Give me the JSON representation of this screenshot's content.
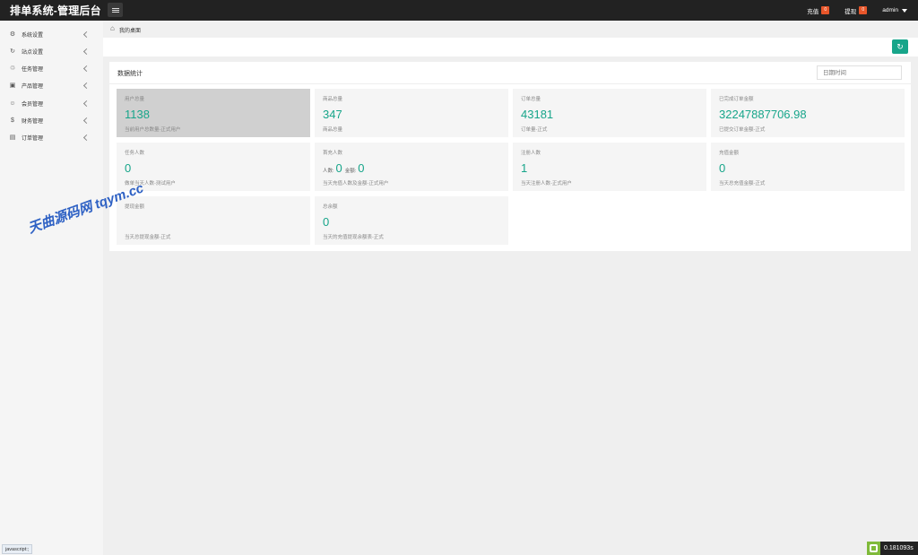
{
  "header": {
    "brand": "排单系统-管理后台",
    "recharge_label": "充值",
    "recharge_badge": "0",
    "withdraw_label": "提现",
    "withdraw_badge": "0",
    "user": "admin"
  },
  "sidebar": {
    "items": [
      {
        "label": "系统设置",
        "icon": "settings-icon"
      },
      {
        "label": "站点设置",
        "icon": "refresh-icon"
      },
      {
        "label": "任务管理",
        "icon": "task-icon"
      },
      {
        "label": "产品管理",
        "icon": "box-icon"
      },
      {
        "label": "会员管理",
        "icon": "user-icon"
      },
      {
        "label": "财务管理",
        "icon": "dollar-icon"
      },
      {
        "label": "订单管理",
        "icon": "order-icon"
      }
    ]
  },
  "breadcrumb": {
    "current": "我的桌面"
  },
  "panel": {
    "title": "数据统计",
    "date_placeholder": "日期时间"
  },
  "cards": [
    {
      "label": "用户总量",
      "value": "1138",
      "sub": "当前用户总数量-正式用户"
    },
    {
      "label": "商品总量",
      "value": "347",
      "sub": "商品总量"
    },
    {
      "label": "订单总量",
      "value": "43181",
      "sub": "订单量-正式"
    },
    {
      "label": "已完成订单金额",
      "value": "32247887706.98",
      "sub": "已提交订单金额-正式"
    },
    {
      "label": "任务人数",
      "value": "0",
      "sub": "做单当天人数-测试用户"
    },
    {
      "label": "首充人数",
      "people_label": "人数:",
      "people_value": "0",
      "amount_label": "金额:",
      "amount_value": "0",
      "sub": "当天充值人数及金额-正式用户"
    },
    {
      "label": "注册人数",
      "value": "1",
      "sub": "当天注册人数-正式用户"
    },
    {
      "label": "充值金额",
      "value": "0",
      "sub": "当天总充值金额-正式"
    },
    {
      "label": "提现金额",
      "value": "",
      "sub": "当天总提现金额-正式"
    },
    {
      "label": "总余额",
      "value": "0",
      "sub": "当天的充值提现余额表-正式"
    }
  ],
  "watermark": "天曲源码网 tqym.cc",
  "statusbar": {
    "text": "javascript:;"
  },
  "timer": {
    "value": "0.181093s"
  },
  "colors": {
    "accent": "#17a58a",
    "topbar": "#222222",
    "badge": "#e8562a"
  }
}
